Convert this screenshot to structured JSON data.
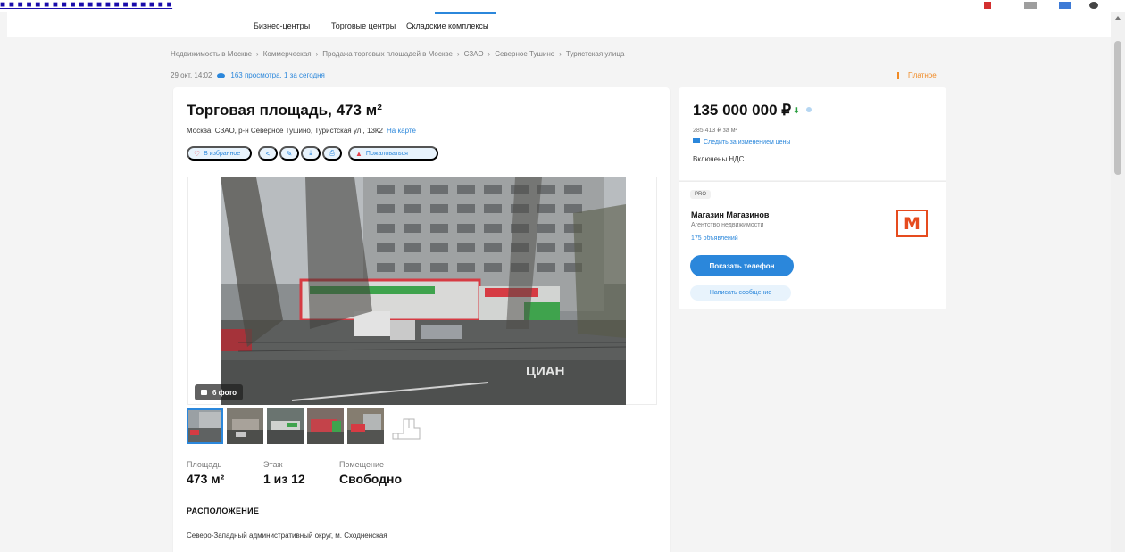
{
  "browser": {
    "url_fragment": "■ ■ ■ ■ ■ ■ ■ ■ ■ ■ ■ ■ ■ ■ ■ ■ ■ ■ ■ ■"
  },
  "topnav": {
    "items": [
      "Бизнес-центры",
      "Торговые центры",
      "Складские комплексы"
    ]
  },
  "breadcrumbs": [
    "Недвижимость в Москве",
    "Коммерческая",
    "Продажа торговых площадей в Москве",
    "СЗАО",
    "Северное Тушино",
    "Туристская улица"
  ],
  "meta": {
    "date": "29 окт, 14:02",
    "views": "163 просмотра, 1 за сегодня",
    "paid": "Платное"
  },
  "listing": {
    "title": "Торговая площадь, 473 м²",
    "address": "Москва, СЗАО, р-н Северное Тушино, Туристская ул., 13К2",
    "map_link": "На карте",
    "actions": {
      "favorite": "В избранное",
      "complain": "Пожаловаться"
    },
    "photo_count": "6 фото",
    "photo_watermark": "ЦИАН",
    "facts": [
      {
        "label": "Площадь",
        "value": "473 м²"
      },
      {
        "label": "Этаж",
        "value": "1 из 12"
      },
      {
        "label": "Помещение",
        "value": "Свободно"
      }
    ],
    "location_heading": "РАСПОЛОЖЕНИЕ",
    "location_text": "Северо-Западный административный округ, м. Сходненская"
  },
  "price": {
    "value": "135 000 000 ₽",
    "per_sqm": "285 413 ₽ за м²",
    "follow": "Следить за изменением цены",
    "vat": "Включены НДС"
  },
  "agent": {
    "badge": "PRO",
    "name": "Магазин Магазинов",
    "type": "Агентство недвижимости",
    "listings": "175 объявлений",
    "logo_letter": "М",
    "phone_button": "Показать телефон",
    "message_button": "Написать сообщение"
  },
  "colors": {
    "accent": "#2b87db",
    "price_down": "#2a9d3f",
    "paid": "#f08a24",
    "logo": "#e64b1e"
  }
}
